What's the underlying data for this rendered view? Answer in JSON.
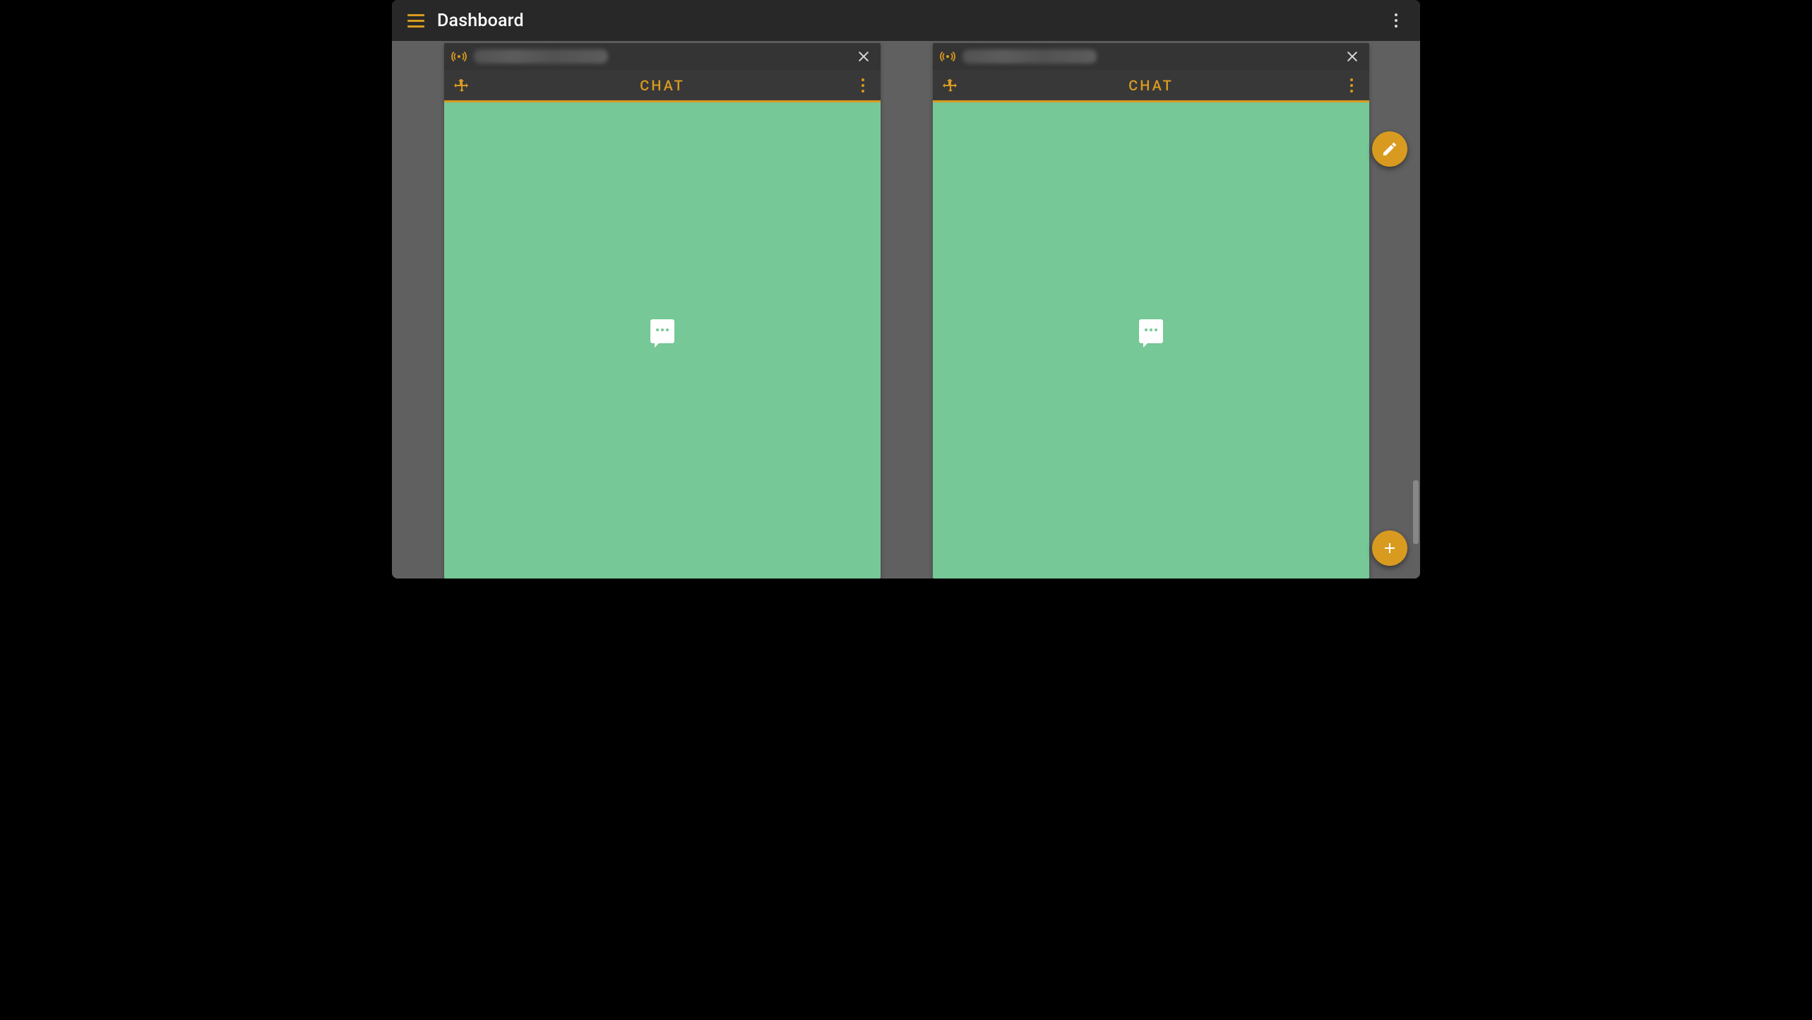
{
  "appbar": {
    "title": "Dashboard"
  },
  "panels": [
    {
      "tab_label": "CHAT"
    },
    {
      "tab_label": "CHAT"
    }
  ],
  "icons": {
    "hamburger": "hamburger-icon",
    "appbar_overflow": "vertical-dots-icon",
    "beacon": "beacon-icon",
    "close": "close-icon",
    "move": "move-arrows-icon",
    "panel_overflow": "vertical-dots-icon",
    "chat_bubble": "chat-bubble-icon",
    "edit": "pencil-icon",
    "add": "plus-icon"
  },
  "colors": {
    "accent": "#d99b1f",
    "panel_body": "#76c897",
    "appbar_bg": "#282828",
    "panel_header_bg": "#343434",
    "panel_tabbar_bg": "#383838",
    "workspace_bg": "#606060"
  }
}
